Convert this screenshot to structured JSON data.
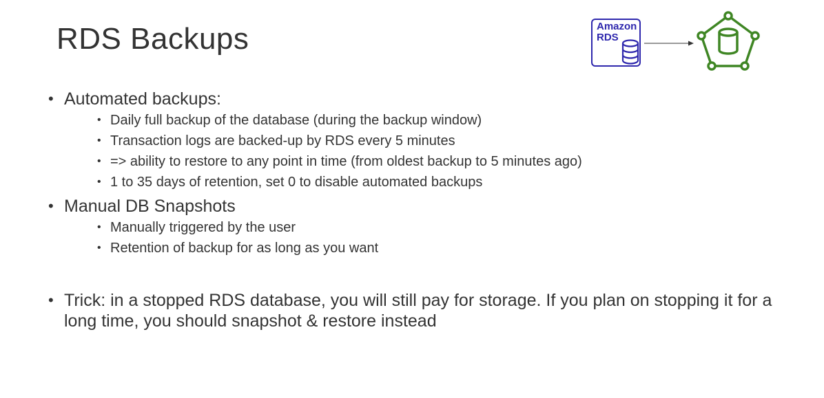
{
  "slide": {
    "title": "RDS Backups",
    "logo": {
      "rds_text_line1": "Amazon",
      "rds_text_line2": "RDS",
      "rds_color": "#2e27ad",
      "snapshot_color": "#3f8624",
      "icons": [
        "rds-database-icon",
        "arrow-right-icon",
        "rds-snapshot-icon"
      ]
    },
    "bullets": [
      {
        "text": "Automated backups:",
        "children": [
          "Daily full backup of the database (during the backup window)",
          "Transaction logs are backed-up by RDS every 5 minutes",
          "=> ability to restore to any point in time (from oldest backup to 5 minutes ago)",
          "1 to 35 days of retention, set 0 to disable automated backups"
        ]
      },
      {
        "text": "Manual DB Snapshots",
        "children": [
          "Manually triggered by the user",
          "Retention of backup for as long as you want"
        ]
      },
      {
        "text": "Trick: in a stopped RDS database, you will still pay for storage. If you plan on stopping it for a long time, you should snapshot & restore instead",
        "children": []
      }
    ]
  }
}
